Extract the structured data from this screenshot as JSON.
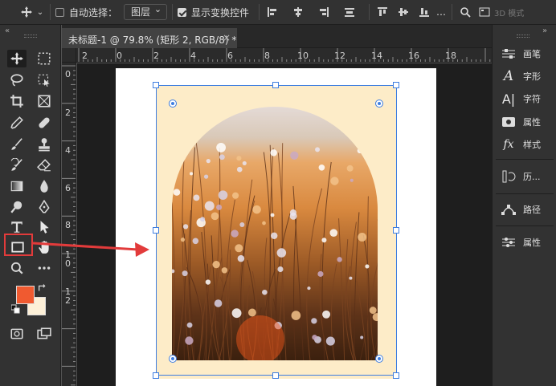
{
  "options_bar": {
    "auto_select_label": "自动选择：",
    "layer_select_value": "图层",
    "show_transform_label": "显示变换控件",
    "mode_3d_label": "3D 模式"
  },
  "document": {
    "tab_title": "未标题-1 @ 79.8% (矩形 2, RGB/8) *",
    "close_glyph": "×",
    "ruler_top_ticks": [
      "2",
      "0",
      "2",
      "4",
      "6",
      "8",
      "10",
      "12",
      "14",
      "16",
      "18"
    ],
    "ruler_left_ticks": [
      "0",
      "2",
      "4",
      "6",
      "8",
      "1\n0",
      "1\n2"
    ]
  },
  "right_panel": {
    "items": [
      {
        "label": "画笔",
        "icon": "brush-settings-icon"
      },
      {
        "label": "字形",
        "icon": "glyphs-icon"
      },
      {
        "label": "字符",
        "icon": "character-icon"
      },
      {
        "label": "属性",
        "icon": "properties-icon"
      },
      {
        "label": "样式",
        "icon": "styles-icon"
      },
      {
        "label": "历...",
        "icon": "history-icon"
      },
      {
        "label": "路径",
        "icon": "paths-icon"
      },
      {
        "label": "属性",
        "icon": "adjust-properties-icon"
      }
    ]
  },
  "colors": {
    "foreground": "#f05a30",
    "background": "#fdf0d8",
    "highlight": "#e23b3b",
    "transform": "#3d7de0"
  }
}
